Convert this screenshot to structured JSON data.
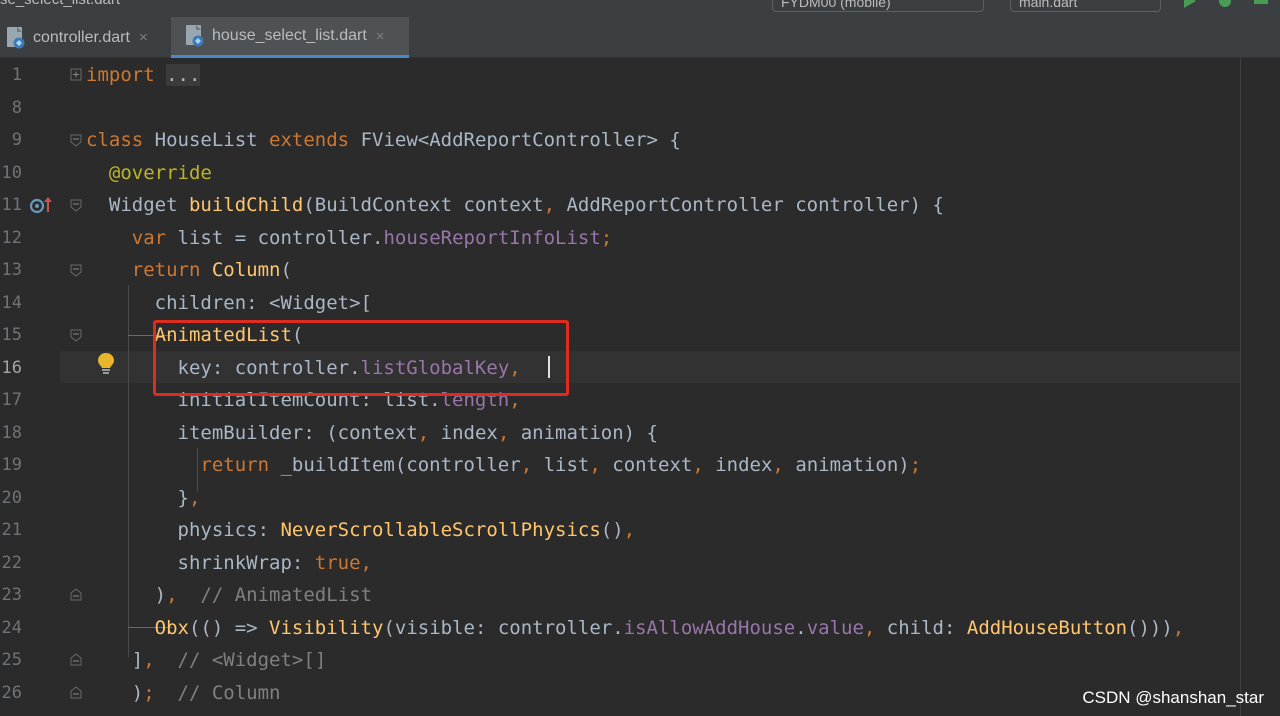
{
  "topbar": {
    "crumb": "se_select_list.dart",
    "device": "FYDM00 (mobile)",
    "run_config": "main.dart"
  },
  "tabs": [
    {
      "label": "controller.dart",
      "close": "×"
    },
    {
      "label": "house_select_list.dart",
      "close": "×"
    }
  ],
  "editor": {
    "line_numbers": [
      "1",
      "8",
      "9",
      "10",
      "11",
      "12",
      "13",
      "14",
      "15",
      "16",
      "17",
      "18",
      "19",
      "20",
      "21",
      "22",
      "23",
      "24",
      "25",
      "26"
    ],
    "current_line": "16",
    "lines": [
      {
        "t1": "import",
        "t2": " ",
        "t3": "..."
      },
      {},
      {
        "t1": "class",
        "t2": " HouseList ",
        "t3": "extends",
        "t4": " FView<AddReportController> {"
      },
      {
        "t1": "  ",
        "t2": "@override"
      },
      {
        "t1": "  Widget ",
        "t2": "buildChild",
        "t3": "(BuildContext context",
        "t4": ",",
        "t5": " AddReportController controller) {"
      },
      {
        "t1": "    ",
        "t2": "var",
        "t3": " list = controller.",
        "t4": "houseReportInfoList",
        "t5": ";"
      },
      {
        "t1": "    ",
        "t2": "return",
        "t3": " ",
        "t4": "Column",
        "t5": "("
      },
      {
        "t1": "      children: <Widget>["
      },
      {
        "t1": "      ",
        "t2": "AnimatedList",
        "t3": "("
      },
      {
        "t1": "        key: controller.",
        "t2": "listGlobalKey",
        "t3": ","
      },
      {
        "t1": "        initialItemCount: list.",
        "t2": "length",
        "t3": ","
      },
      {
        "t1": "        itemBuilder: (context",
        "t2": ",",
        "t3": " index",
        "t4": ",",
        "t5": " animation) {"
      },
      {
        "t1": "          ",
        "t2": "return",
        "t3": " _buildItem(controller",
        "t4": ",",
        "t5": " list",
        "t6": ",",
        "t7": " context",
        "t8": ",",
        "t9": " index",
        "t10": ",",
        "t11": " animation)",
        "t12": ";"
      },
      {
        "t1": "        }",
        "t2": ","
      },
      {
        "t1": "        physics: ",
        "t2": "NeverScrollableScrollPhysics",
        "t3": "()",
        "t4": ","
      },
      {
        "t1": "        shrinkWrap: ",
        "t2": "true",
        "t3": ","
      },
      {
        "t1": "      )",
        "t2": ",",
        "t3": "  ",
        "t4": "// AnimatedList"
      },
      {
        "t1": "      ",
        "t2": "Obx",
        "t3": "(() => ",
        "t4": "Visibility",
        "t5": "(visible: controller.",
        "t6": "isAllowAddHouse",
        "t7": ".",
        "t8": "value",
        "t9": ",",
        "t10": " child: ",
        "t11": "AddHouseButton",
        "t12": "()))",
        "t13": ","
      },
      {
        "t1": "    ]",
        "t2": ",",
        "t3": "  ",
        "t4": "// <Widget>[]"
      },
      {
        "t1": "    )",
        "t2": ";",
        "t3": "  ",
        "t4": "// Column"
      }
    ]
  },
  "watermark": "CSDN @shanshan_star",
  "colors": {
    "background": "#2b2b2b",
    "keyword": "#cc7832",
    "function": "#ffc66d",
    "field": "#9876aa",
    "annotation": "#bbb529",
    "comment": "#808080",
    "highlight_box": "#e02c1f",
    "tab_underline": "#4a88c7"
  },
  "icons": {
    "file": "dart-file-icon",
    "override": "override-marker-icon",
    "intention": "lightbulb-icon",
    "run": "run-icon",
    "debug": "debug-icon"
  }
}
